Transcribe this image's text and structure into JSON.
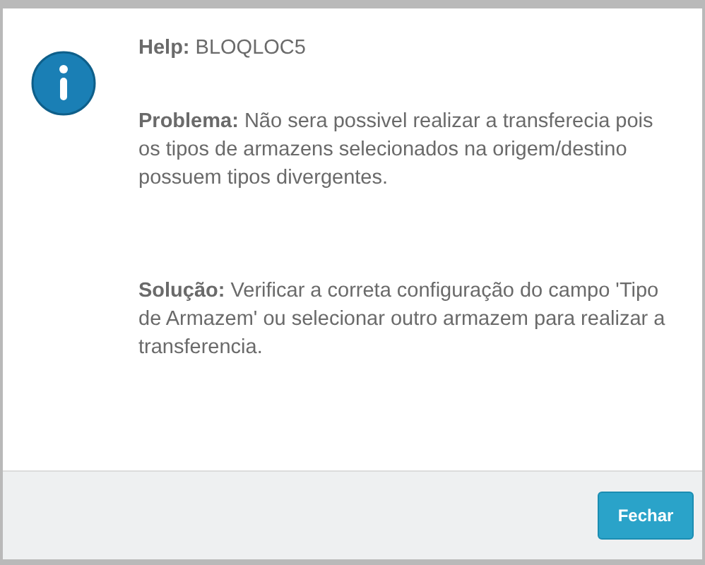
{
  "title": "**Help:** BLOQLOC5",
  "paragraphs": [
    "**Problema:** Não sera possivel realizar a transferecia pois os tipos de armazens selecionados na origem/destino possuem tipos divergentes.",
    "**Solução:** Verificar a correta configuração do campo 'Tipo de Armazem' ou selecionar outro armazem para realizar a transferencia."
  ],
  "buttons": [
    "Fechar"
  ]
}
